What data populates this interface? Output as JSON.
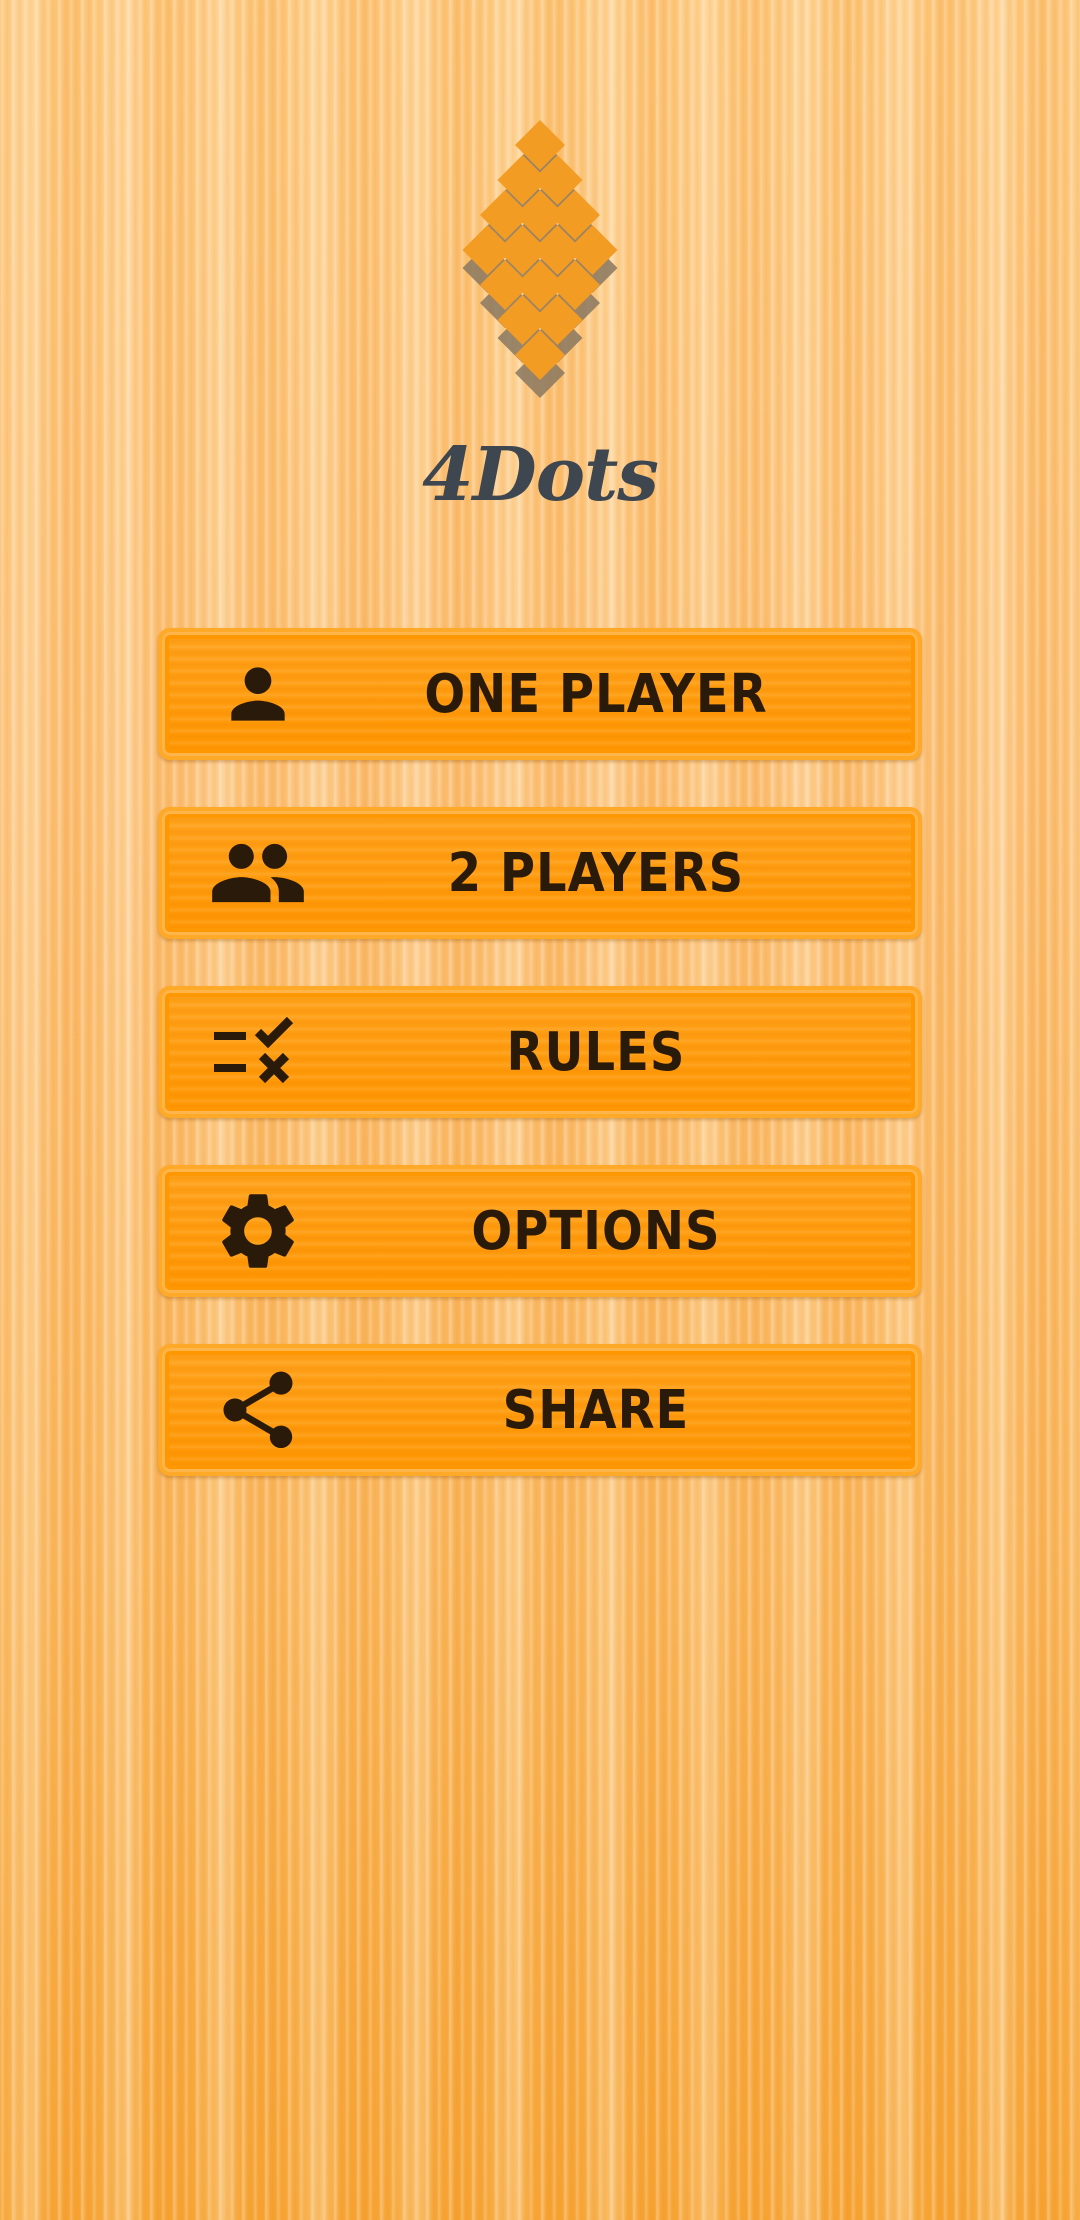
{
  "app": {
    "title": "4Dots"
  },
  "menu": {
    "items": [
      {
        "label": "ONE PLAYER",
        "icon": "person-icon"
      },
      {
        "label": "2 PLAYERS",
        "icon": "people-icon"
      },
      {
        "label": "RULES",
        "icon": "rules-checklist-icon"
      },
      {
        "label": "OPTIONS",
        "icon": "gear-icon"
      },
      {
        "label": "SHARE",
        "icon": "share-icon"
      }
    ]
  },
  "colors": {
    "background": "#f7b245",
    "button": "#ff9800",
    "button_text": "#2a1a0a",
    "title": "#3e4650",
    "logo_orange": "#f39c24",
    "logo_gray": "#8a7860"
  }
}
